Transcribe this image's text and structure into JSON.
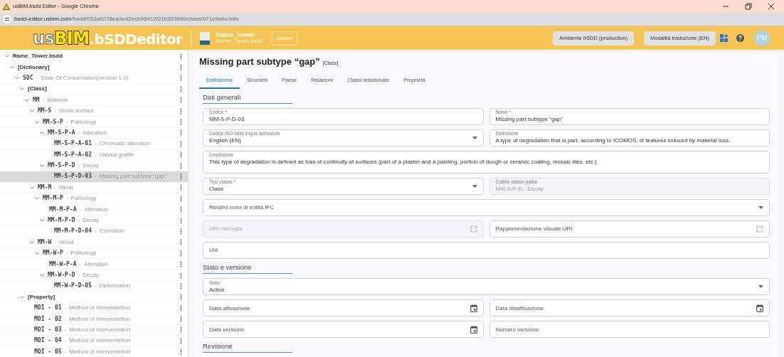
{
  "browser": {
    "title": "usBIM.bsdd Editor - Google Chrome",
    "url_host": "bsdd-editor.usbim.com",
    "url_path": "/bsdd/053a9278ea3e42ecb08412f21b353990/class/971e9e6e/info"
  },
  "header": {
    "logo": {
      "prefix": "us",
      "highlight": "BIM",
      "suffix": ".bSDDeditor"
    },
    "project": {
      "name": "Rame_Tower",
      "file": "Rame_Tower.bsdd",
      "badge": "Bozza"
    },
    "buttons": [
      "Ambiente bSDD (production)",
      "Modalità traduzione (EN)"
    ],
    "avatar": "PM"
  },
  "sidebar": {
    "separator": "-",
    "tree": [
      {
        "kind": "folder",
        "code": "Rame_Tower.bsdd",
        "expanded": true,
        "selected": false,
        "children": [
          {
            "kind": "folder",
            "code": "[Dictionary]",
            "expanded": true,
            "selected": false,
            "children": [
              {
                "kind": "code",
                "code": "SOC",
                "name": "State Of Conservation(version 1.0)",
                "expanded": true,
                "selected": false,
                "children": [
                  {
                    "kind": "folder",
                    "code": "[Class]",
                    "expanded": true,
                    "selected": false,
                    "children": [
                      {
                        "kind": "code",
                        "code": "MM",
                        "name": "Material",
                        "expanded": true,
                        "selected": false,
                        "children": [
                          {
                            "kind": "code",
                            "code": "MM-S",
                            "name": "Stone surface",
                            "expanded": true,
                            "selected": false,
                            "children": [
                              {
                                "kind": "code",
                                "code": "MM-S-P",
                                "name": "Pathology",
                                "expanded": true,
                                "selected": false,
                                "children": [
                                  {
                                    "kind": "code",
                                    "code": "MM-S-P-A",
                                    "name": "Alteration",
                                    "expanded": true,
                                    "selected": false,
                                    "children": [
                                      {
                                        "kind": "code",
                                        "code": "MM-S-P-A-01",
                                        "name": "Chromatic alteration",
                                        "selected": false
                                      },
                                      {
                                        "kind": "code",
                                        "code": "MM-S-P-A-02",
                                        "name": "Vandal graffiti",
                                        "selected": false
                                      }
                                    ]
                                  },
                                  {
                                    "kind": "code",
                                    "code": "MM-S-P-D",
                                    "name": "Decay",
                                    "expanded": true,
                                    "selected": false,
                                    "children": [
                                      {
                                        "kind": "code",
                                        "code": "MM-S-P-D-03",
                                        "name": "Missing part subtype \"gap\"",
                                        "selected": true
                                      }
                                    ]
                                  }
                                ]
                              }
                            ]
                          },
                          {
                            "kind": "code",
                            "code": "MM-M",
                            "name": "Metal",
                            "expanded": true,
                            "selected": false,
                            "children": [
                              {
                                "kind": "code",
                                "code": "MM-M-P",
                                "name": "Pathology",
                                "expanded": true,
                                "selected": false,
                                "children": [
                                  {
                                    "kind": "code",
                                    "code": "MM-M-P-A",
                                    "name": "Alteration",
                                    "selected": false
                                  },
                                  {
                                    "kind": "code",
                                    "code": "MM-M-P-D",
                                    "name": "Decay",
                                    "expanded": true,
                                    "selected": false,
                                    "children": [
                                      {
                                        "kind": "code",
                                        "code": "MM-M-P-D-04",
                                        "name": "Corrosion",
                                        "selected": false
                                      }
                                    ]
                                  }
                                ]
                              }
                            ]
                          },
                          {
                            "kind": "code",
                            "code": "MM-W",
                            "name": "Wood",
                            "expanded": true,
                            "selected": false,
                            "children": [
                              {
                                "kind": "code",
                                "code": "MM-W-P",
                                "name": "Pathology",
                                "expanded": true,
                                "selected": false,
                                "children": [
                                  {
                                    "kind": "code",
                                    "code": "MM-W-P-A",
                                    "name": "Alteration",
                                    "selected": false
                                  },
                                  {
                                    "kind": "code",
                                    "code": "MM-W-P-D",
                                    "name": "Decay",
                                    "expanded": true,
                                    "selected": false,
                                    "children": [
                                      {
                                        "kind": "code",
                                        "code": "MM-W-P-D-05",
                                        "name": "Deformation",
                                        "selected": false
                                      }
                                    ]
                                  }
                                ]
                              }
                            ]
                          }
                        ]
                      }
                    ]
                  },
                  {
                    "kind": "folder",
                    "code": "[Property]",
                    "expanded": true,
                    "selected": false,
                    "children": [
                      {
                        "kind": "code",
                        "code": "MOI - 01",
                        "name": "Method of Interventetion",
                        "selected": false
                      },
                      {
                        "kind": "code",
                        "code": "MOI - 02",
                        "name": "Method of Interventetion",
                        "selected": false
                      },
                      {
                        "kind": "code",
                        "code": "MOI - 03",
                        "name": "Method of Interventetion",
                        "selected": false
                      },
                      {
                        "kind": "code",
                        "code": "MOI - 04",
                        "name": "Method of Interventetion",
                        "selected": false
                      },
                      {
                        "kind": "code",
                        "code": "MOI - 05",
                        "name": "Method of Interventetion",
                        "selected": false
                      }
                    ]
                  }
                ]
              }
            ]
          }
        ]
      }
    ]
  },
  "main": {
    "title": "Missing part subtype “gap”",
    "title_tag": "[Class]",
    "tabs": [
      {
        "label": "Definizione",
        "selected": true
      },
      {
        "label": "Sinonimi",
        "selected": false
      },
      {
        "label": "Paese",
        "selected": false
      },
      {
        "label": "Relazioni",
        "selected": false
      },
      {
        "label": "Classi relazionate",
        "selected": false
      },
      {
        "label": "Proprietà",
        "selected": false
      }
    ],
    "sections": [
      {
        "title": "Dati generali",
        "rows": [
          [
            {
              "kind": "text",
              "label": "Codice *",
              "value": "MM-S-P-D-03",
              "disabled": false
            },
            {
              "kind": "text",
              "label": "Nome *",
              "value": "Missing part subtype \"gap\"",
              "disabled": false
            }
          ],
          [
            {
              "kind": "select",
              "label": "Codice ISO della lingua dell'autore",
              "value": "English (EN)",
              "disabled": false
            },
            {
              "kind": "text",
              "label": "Definizione",
              "value": "A type of degradation that is part, according to ICOMOS, di features induced by material loss.",
              "disabled": false
            }
          ],
          [
            {
              "kind": "textarea",
              "label": "Descrizione",
              "value": "This type of degradation is defined as loss of continuity of surfaces (part of a plaster and a painting, portion of dough or ceramic coating, mosaic tiles, etc.).",
              "disabled": false
            }
          ],
          [
            {
              "kind": "select",
              "label": "Tipo classe *",
              "value": "Class",
              "disabled": false
            },
            {
              "kind": "text",
              "label": "Codice classe padre",
              "value": "MM-S-P-D - Decay",
              "disabled": true
            }
          ],
          [
            {
              "kind": "select",
              "placeholder": "Relativi nomi di entità IFC",
              "disabled": false
            }
          ],
          [
            {
              "kind": "link",
              "placeholder": "URI riservata",
              "disabled": true
            },
            {
              "kind": "link",
              "placeholder": "Rappresentazione visuale URI",
              "disabled": false
            }
          ],
          [
            {
              "kind": "text",
              "placeholder": "Uid",
              "disabled": false
            }
          ]
        ]
      },
      {
        "title": "Stato e versione",
        "rows": [
          [
            {
              "kind": "select",
              "label": "Stato",
              "value": "Active",
              "disabled": false
            }
          ],
          [
            {
              "kind": "date",
              "placeholder": "Data attivazione",
              "disabled": false
            },
            {
              "kind": "date",
              "placeholder": "Data disattivazione",
              "disabled": false
            }
          ],
          [
            {
              "kind": "date",
              "placeholder": "Data versione",
              "disabled": false
            },
            {
              "kind": "text",
              "placeholder": "Numero versione",
              "disabled": false
            }
          ]
        ]
      },
      {
        "title": "Revisione"
      }
    ]
  }
}
